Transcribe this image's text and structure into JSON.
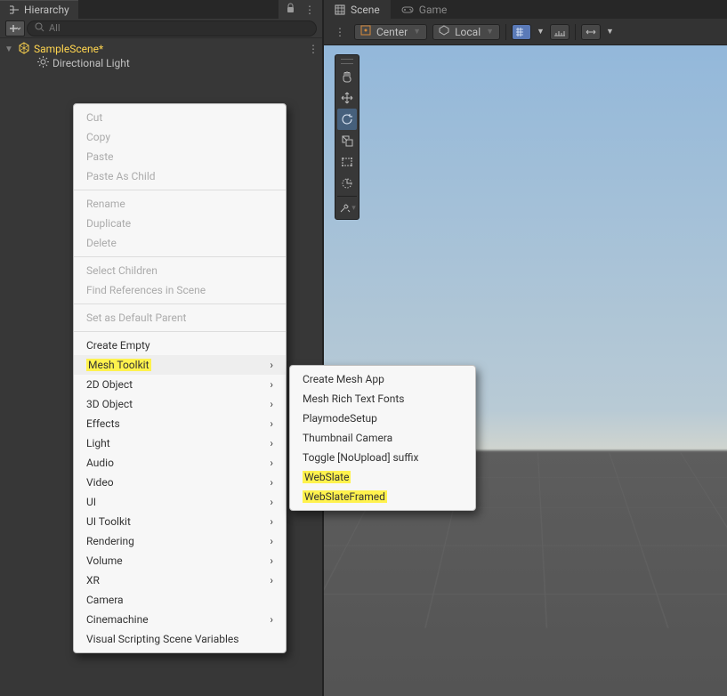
{
  "hierarchy": {
    "tab_label": "Hierarchy",
    "search_placeholder": "All",
    "scene_name": "SampleScene*",
    "child_name": "Directional Light"
  },
  "scene_panel": {
    "tab_scene": "Scene",
    "tab_game": "Game",
    "pivot_mode": "Center",
    "space_mode": "Local"
  },
  "context_menu": {
    "cut": "Cut",
    "copy": "Copy",
    "paste": "Paste",
    "paste_as_child": "Paste As Child",
    "rename": "Rename",
    "duplicate": "Duplicate",
    "delete": "Delete",
    "select_children": "Select Children",
    "find_refs": "Find References in Scene",
    "set_default_parent": "Set as Default Parent",
    "create_empty": "Create Empty",
    "mesh_toolkit": "Mesh Toolkit",
    "obj2d": "2D Object",
    "obj3d": "3D Object",
    "effects": "Effects",
    "light": "Light",
    "audio": "Audio",
    "video": "Video",
    "ui": "UI",
    "ui_toolkit": "UI Toolkit",
    "rendering": "Rendering",
    "volume": "Volume",
    "xr": "XR",
    "camera": "Camera",
    "cinemachine": "Cinemachine",
    "vssv": "Visual Scripting Scene Variables"
  },
  "submenu": {
    "create_mesh_app": "Create Mesh App",
    "mesh_rich_text_fonts": "Mesh Rich Text Fonts",
    "playmode_setup": "PlaymodeSetup",
    "thumbnail_camera": "Thumbnail Camera",
    "toggle_noupload": "Toggle [NoUpload] suffix",
    "webslate": "WebSlate",
    "webslate_framed": "WebSlateFramed"
  }
}
